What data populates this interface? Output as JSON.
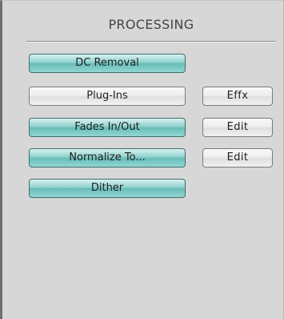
{
  "panel": {
    "title": "PROCESSING"
  },
  "buttons": [
    {
      "label": "DC Removal",
      "state": "on"
    },
    {
      "label": "Plug-Ins",
      "state": "off",
      "side_label": "Effx"
    },
    {
      "label": "Fades In/Out",
      "state": "on",
      "side_label": "Edit"
    },
    {
      "label": "Normalize To...",
      "state": "on",
      "side_label": "Edit"
    },
    {
      "label": "Dither",
      "state": "on"
    }
  ],
  "colors": {
    "panel_background": "#d7d7d7",
    "button_on": "#7cc8c3",
    "button_off": "#e8e8e8"
  }
}
